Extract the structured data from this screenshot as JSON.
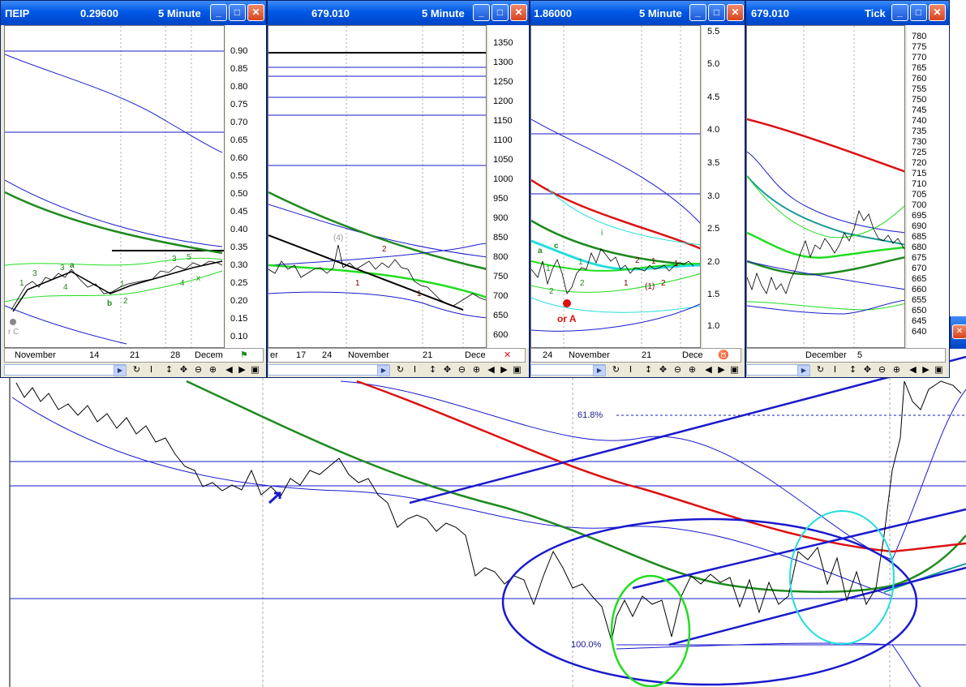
{
  "background": {
    "retracement_618": "61.8%",
    "retracement_100": "100.0%",
    "colors": {
      "price": "#000000",
      "blue": "#1a1acc",
      "green": "#1e8a1e",
      "red": "#dd1111",
      "lime": "#22dd22",
      "cyan": "#22dddd"
    }
  },
  "windows": [
    {
      "symbol": "ΠΕΙΡ",
      "price": "0.29600",
      "interval": "5 Minute",
      "scale": [
        "0.90",
        "0.85",
        "0.80",
        "0.75",
        "0.70",
        "0.65",
        "0.60",
        "0.55",
        "0.50",
        "0.45",
        "0.40",
        "0.35",
        "0.30",
        "0.25",
        "0.20",
        "0.15",
        "0.10"
      ],
      "dates": [
        "November",
        "14",
        "21",
        "28",
        "Decem"
      ],
      "labels": [
        "r C",
        "1",
        "3",
        "3",
        "a",
        "4",
        "b",
        "2",
        "1",
        "3",
        "5",
        "4",
        "x"
      ]
    },
    {
      "symbol": "",
      "price": "679.010",
      "interval": "5 Minute",
      "scale": [
        "1350",
        "1300",
        "1250",
        "1200",
        "1150",
        "1100",
        "1050",
        "1000",
        "950",
        "900",
        "850",
        "800",
        "750",
        "700",
        "650",
        "600"
      ],
      "dates": [
        "er",
        "17",
        "24",
        "November",
        "21",
        "Dece"
      ],
      "labels": [
        "(4)",
        "2",
        "1",
        "1"
      ]
    },
    {
      "symbol": "",
      "price": "1.86000",
      "interval": "5 Minute",
      "scale": [
        "5.5",
        "5.0",
        "4.5",
        "4.0",
        "3.5",
        "3.0",
        "2.5",
        "2.0",
        "1.5",
        "1.0"
      ],
      "dates": [
        "24",
        "November",
        "21",
        "Dece"
      ],
      "labels": [
        "a",
        "c",
        "1",
        "2",
        "2",
        "1",
        "i",
        "1",
        "2",
        "1",
        "2",
        "(1)",
        "1",
        "or A"
      ]
    },
    {
      "symbol": "",
      "price": "679.010",
      "interval": "Tick",
      "scale": [
        "780",
        "775",
        "770",
        "765",
        "760",
        "755",
        "750",
        "745",
        "740",
        "735",
        "730",
        "725",
        "720",
        "715",
        "710",
        "705",
        "700",
        "695",
        "690",
        "685",
        "680",
        "675",
        "670",
        "665",
        "660",
        "655",
        "650",
        "645",
        "640"
      ],
      "dates": [
        "December",
        "5"
      ],
      "labels": []
    }
  ]
}
